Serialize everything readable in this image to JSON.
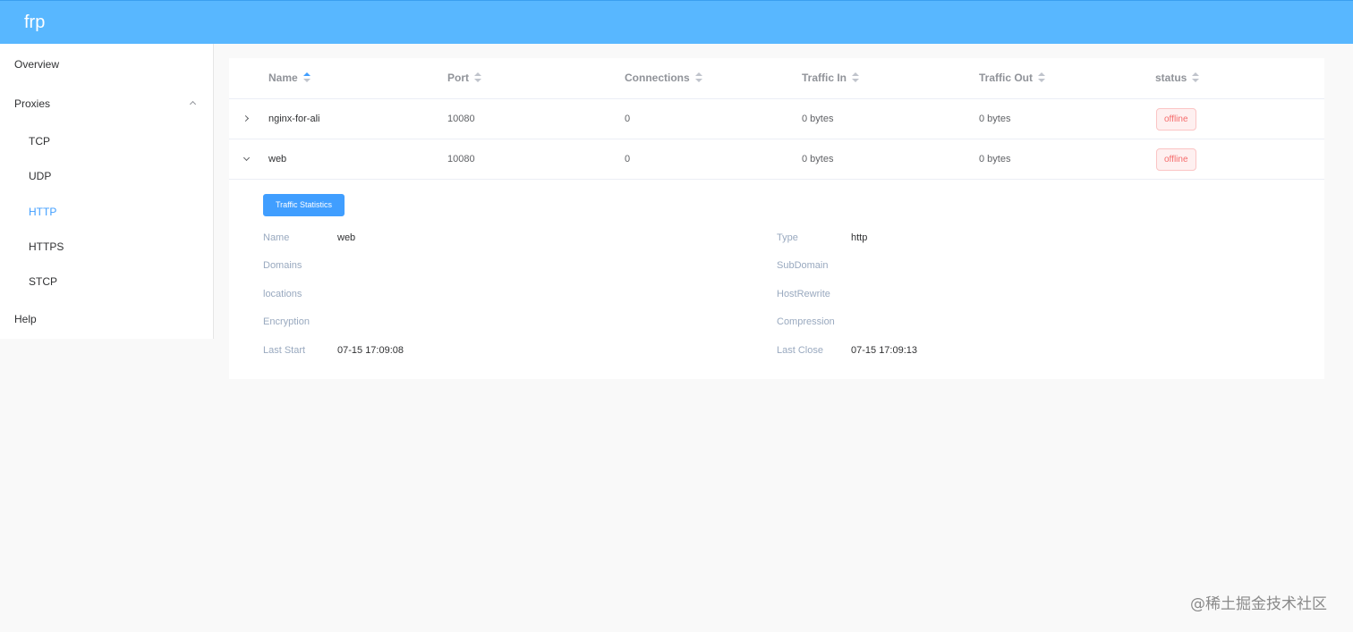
{
  "app": {
    "brand": "frp"
  },
  "sidebar": {
    "items": [
      {
        "label": "Overview"
      },
      {
        "label": "Proxies"
      },
      {
        "label": "TCP"
      },
      {
        "label": "UDP"
      },
      {
        "label": "HTTP"
      },
      {
        "label": "HTTPS"
      },
      {
        "label": "STCP"
      },
      {
        "label": "Help"
      }
    ],
    "active": "HTTP"
  },
  "table": {
    "columns": [
      "Name",
      "Port",
      "Connections",
      "Traffic In",
      "Traffic Out",
      "status"
    ],
    "sort": {
      "column": "Name",
      "direction": "ascending"
    },
    "rows": [
      {
        "name": "nginx-for-ali",
        "port": "10080",
        "connections": "0",
        "traffic_in": "0 bytes",
        "traffic_out": "0 bytes",
        "status": "offline",
        "expanded": false
      },
      {
        "name": "web",
        "port": "10080",
        "connections": "0",
        "traffic_in": "0 bytes",
        "traffic_out": "0 bytes",
        "status": "offline",
        "expanded": true
      }
    ]
  },
  "detail": {
    "button_label": "Traffic Statistics",
    "fields": [
      {
        "label": "Name",
        "value": "web"
      },
      {
        "label": "Type",
        "value": "http"
      },
      {
        "label": "Domains",
        "value": ""
      },
      {
        "label": "SubDomain",
        "value": ""
      },
      {
        "label": "locations",
        "value": ""
      },
      {
        "label": "HostRewrite",
        "value": ""
      },
      {
        "label": "Encryption",
        "value": ""
      },
      {
        "label": "Compression",
        "value": ""
      },
      {
        "label": "Last Start",
        "value": "07-15 17:09:08"
      },
      {
        "label": "Last Close",
        "value": "07-15 17:09:13"
      }
    ]
  },
  "watermark": "@稀土掘金技术社区",
  "colors": {
    "header": "#58b7ff",
    "primary": "#409eff",
    "danger": "#f56c6c"
  }
}
